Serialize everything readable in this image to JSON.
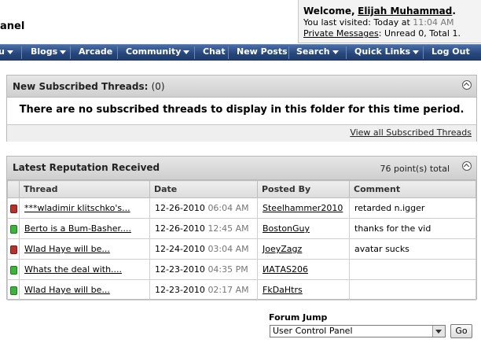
{
  "header": {
    "title_fragment": "anel",
    "welcome_label": "Welcome,",
    "username": "Elijah Muhammad",
    "welcome_period": ".",
    "last_visited_label": "You last visited: Today at",
    "last_visited_time": "11:04 AM",
    "private_messages_link": "Private Messages",
    "pm_status": ": Unread 0, Total 1."
  },
  "navbar": {
    "items": [
      {
        "label": "u",
        "has_menu": true
      },
      {
        "label": "Blogs",
        "has_menu": true
      },
      {
        "label": "Arcade",
        "has_menu": false
      },
      {
        "label": "Community",
        "has_menu": true
      },
      {
        "label": "Chat",
        "has_menu": false
      },
      {
        "label": "New Posts",
        "has_menu": false
      },
      {
        "label": "Search",
        "has_menu": true
      },
      {
        "label": "Quick Links",
        "has_menu": true
      },
      {
        "label": "Log Out",
        "has_menu": false
      }
    ]
  },
  "subscribed": {
    "title": "New Subscribed Threads:",
    "count": "(0)",
    "message": "There are no subscribed threads to display in this folder for this time period.",
    "view_all_link": "View all Subscribed Threads"
  },
  "reputation": {
    "title": "Latest Reputation Received",
    "total": "76 point(s) total",
    "columns": [
      "Thread",
      "Date",
      "Posted By",
      "Comment"
    ],
    "rows": [
      {
        "status": "red",
        "thread": "***wladimir klitschko's...",
        "date": "12-26-2010",
        "time": "06:04 AM",
        "posted_by": "Steelhammer2010",
        "comment": "retarded n.igger"
      },
      {
        "status": "green",
        "thread": "Berto is a Bum-Basher....",
        "date": "12-26-2010",
        "time": "12:45 AM",
        "posted_by": "BostonGuy",
        "comment": "thanks for the vid"
      },
      {
        "status": "red",
        "thread": "Wlad Haye will be...",
        "date": "12-24-2010",
        "time": "03:04 AM",
        "posted_by": "JoeyZagz",
        "comment": "avatar sucks"
      },
      {
        "status": "green",
        "thread": "Whats the deal with....",
        "date": "12-23-2010",
        "time": "04:35 PM",
        "posted_by": "ИАТAS206",
        "comment": ""
      },
      {
        "status": "green",
        "thread": "Wlad Haye will be...",
        "date": "12-23-2010",
        "time": "02:17 AM",
        "posted_by": "FkDaHtrs",
        "comment": ""
      }
    ]
  },
  "forum_jump": {
    "label": "Forum Jump",
    "selected": "User Control Panel",
    "go_label": "Go"
  },
  "colors": {
    "navbar": "#27477c",
    "positive_rep": "#3ab53a",
    "negative_rep": "#b8312a"
  }
}
